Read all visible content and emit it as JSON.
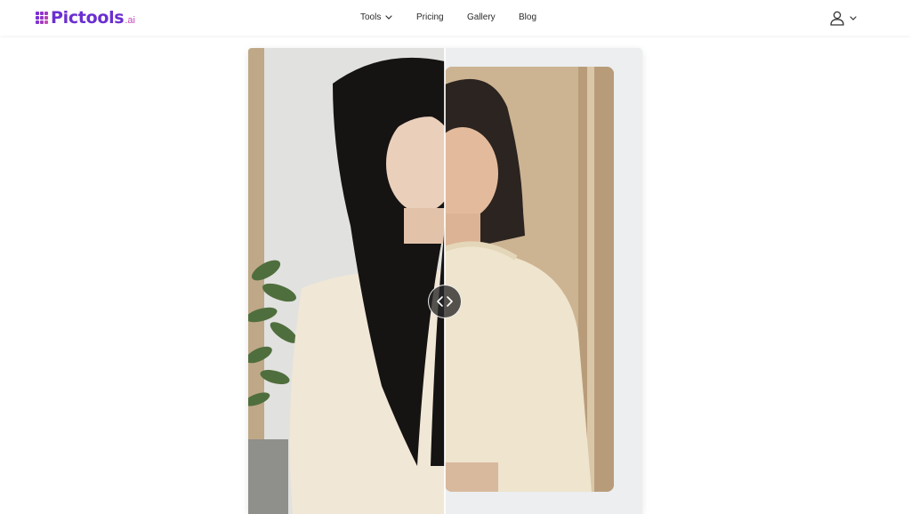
{
  "brand": {
    "name": "Pictools",
    "suffix": ".ai",
    "primary_color": "#6b2fd0",
    "accent_color": "#c44bb8"
  },
  "nav": {
    "items": [
      {
        "label": "Tools",
        "has_dropdown": true
      },
      {
        "label": "Pricing"
      },
      {
        "label": "Gallery"
      },
      {
        "label": "Blog"
      }
    ]
  },
  "user_menu": {
    "icon": "user-icon",
    "dropdown_icon": "chevron-down-icon"
  },
  "compare": {
    "before_image": "woman with long black hair in cream sweater beside plant",
    "after_image": "same woman with shorter hair in cream sweater, framed",
    "handle_icon": "left-right-arrows-icon",
    "split_fraction": 0.5
  }
}
